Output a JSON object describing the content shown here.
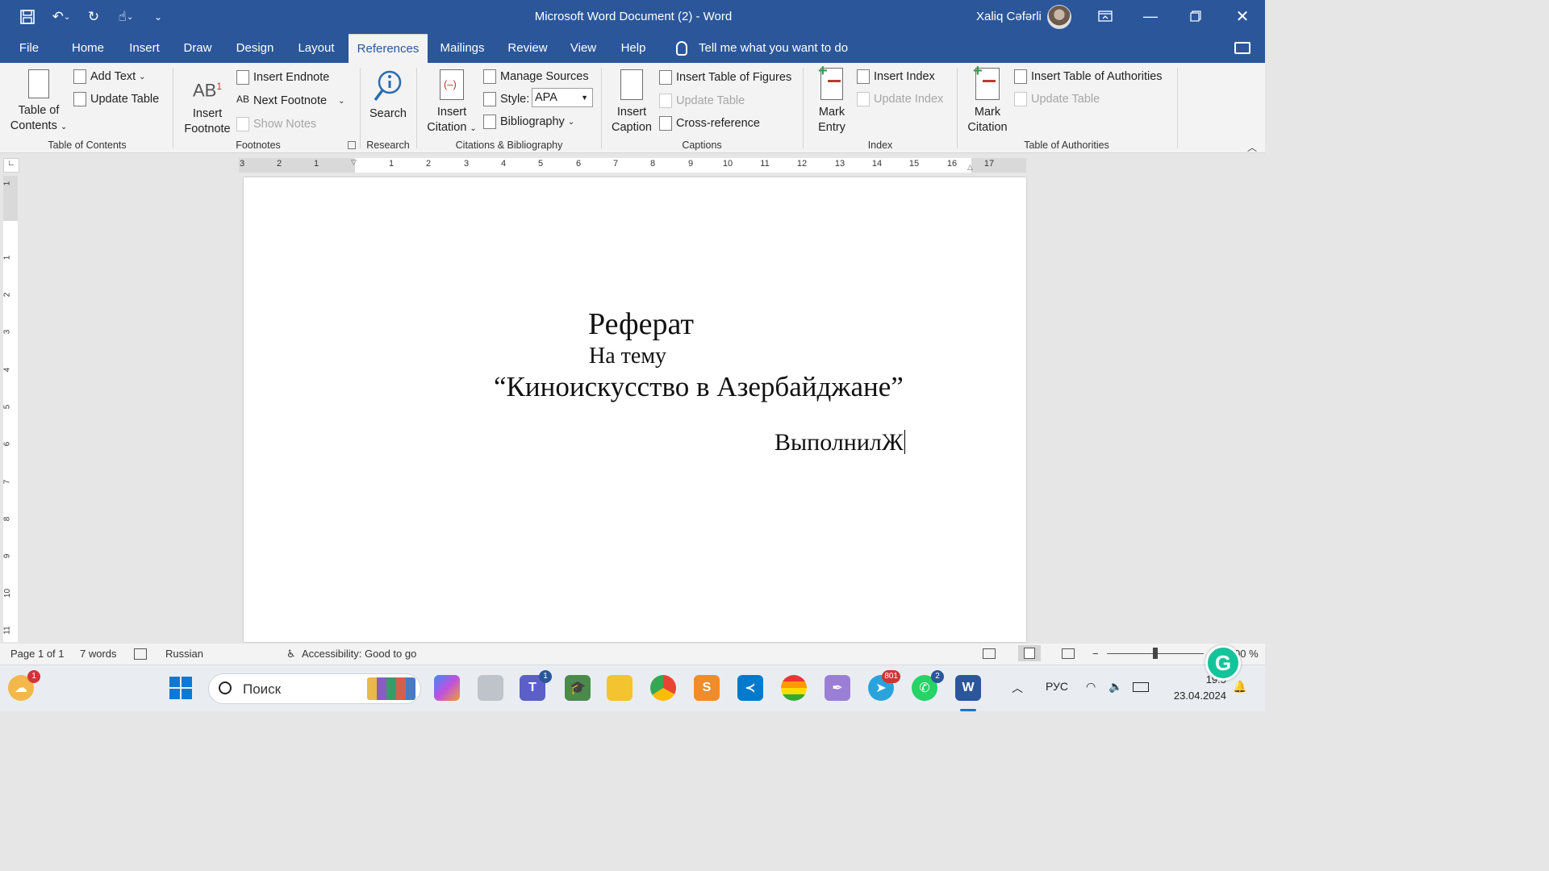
{
  "window": {
    "title": "Microsoft Word Document (2)  -  Word",
    "user_name": "Xaliq Cəfərli"
  },
  "tabs": [
    "File",
    "Home",
    "Insert",
    "Draw",
    "Design",
    "Layout",
    "References",
    "Mailings",
    "Review",
    "View",
    "Help"
  ],
  "active_tab": "References",
  "tell_me": "Tell me what you want to do",
  "ribbon": {
    "toc": {
      "table_of_contents": "Table of",
      "table_of_contents_2": "Contents",
      "add_text": "Add Text",
      "update_table": "Update Table",
      "label": "Table of Contents"
    },
    "footnotes": {
      "insert_footnote": "Insert",
      "insert_footnote_2": "Footnote",
      "insert_endnote": "Insert Endnote",
      "next_footnote": "Next Footnote",
      "show_notes": "Show Notes",
      "label": "Footnotes",
      "icon_text": "AB",
      "icon_sup": "1"
    },
    "research": {
      "search": "Search",
      "label": "Research"
    },
    "citations": {
      "insert_citation": "Insert",
      "insert_citation_2": "Citation",
      "manage_sources": "Manage Sources",
      "style_label": "Style:",
      "style_value": "APA",
      "bibliography": "Bibliography",
      "label": "Citations & Bibliography"
    },
    "captions": {
      "insert_caption": "Insert",
      "insert_caption_2": "Caption",
      "insert_table_of_figures": "Insert Table of Figures",
      "update_table": "Update Table",
      "cross_reference": "Cross-reference",
      "label": "Captions"
    },
    "index": {
      "mark_entry": "Mark",
      "mark_entry_2": "Entry",
      "insert_index": "Insert Index",
      "update_index": "Update Index",
      "label": "Index"
    },
    "authorities": {
      "mark_citation": "Mark",
      "mark_citation_2": "Citation",
      "insert_table_of_authorities": "Insert Table of Authorities",
      "update_table": "Update Table",
      "label": "Table of Authorities"
    }
  },
  "ruler": {
    "h_ticks": [
      "3",
      "2",
      "1",
      "1",
      "2",
      "3",
      "4",
      "5",
      "6",
      "7",
      "8",
      "9",
      "10",
      "11",
      "12",
      "13",
      "14",
      "15",
      "16",
      "17"
    ],
    "v_ticks": [
      "1",
      "1",
      "2",
      "3",
      "4",
      "5",
      "6",
      "7",
      "8",
      "9",
      "10",
      "11"
    ],
    "corner_glyph": "∟"
  },
  "document": {
    "line1": "Реферат",
    "line2": "На тему",
    "line3": "“Киноискусство в Азербайджане”",
    "line4": "ВыполнилЖ"
  },
  "status": {
    "page": "Page 1 of 1",
    "words": "7 words",
    "language": "Russian",
    "accessibility": "Accessibility: Good to go",
    "zoom": "00 %"
  },
  "taskbar": {
    "search_placeholder": "Поиск",
    "weather_badge": "1",
    "teams_badge": "1",
    "telegram_badge": "801",
    "whatsapp_badge": "2",
    "language": "РУС",
    "time": "19:5",
    "date": "23.04.2024"
  },
  "colors": {
    "word_blue": "#2b579a",
    "ribbon_bg": "#f3f3f3"
  }
}
